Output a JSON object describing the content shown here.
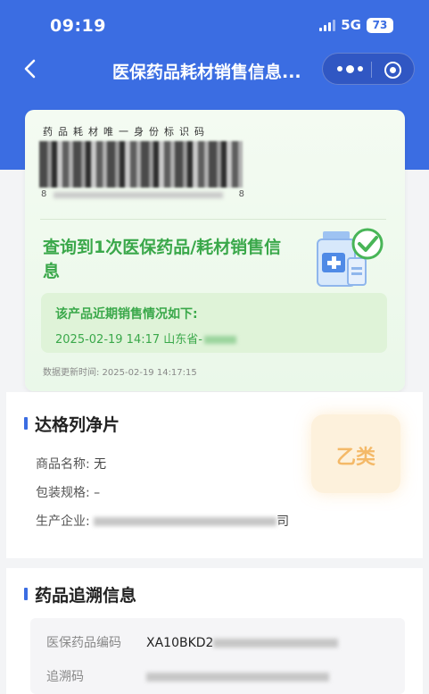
{
  "status_bar": {
    "time": "09:19",
    "network": "5G",
    "battery": "73"
  },
  "nav": {
    "title": "医保药品耗材销售信息..."
  },
  "card": {
    "code_label": "药品耗材唯一身份标识码",
    "barcode_start": "8",
    "barcode_end": "8",
    "result_text": "查询到1次医保药品/耗材销售信息",
    "sales_title": "该产品近期销售情况如下:",
    "sales_record": "2025-02-19 14:17 山东省-",
    "update_time": "数据更新时间: 2025-02-19 14:17:15"
  },
  "product": {
    "title": "达格列净片",
    "badge": "乙类",
    "name_label": "商品名称:",
    "name_value": "无",
    "spec_label": "包装规格:",
    "spec_value": "–",
    "maker_label": "生产企业:",
    "maker_suffix": "司"
  },
  "trace": {
    "title": "药品追溯信息",
    "rows": [
      {
        "label": "医保药品编码",
        "value": "XA10BKD2"
      },
      {
        "label": "追溯码",
        "value": ""
      }
    ]
  },
  "colors": {
    "primary": "#3b6de2",
    "green": "#3aa84a",
    "badge": "#f4b968"
  },
  "icons": [
    "signal-icon",
    "back-arrow-icon",
    "more-dots-icon",
    "close-target-icon",
    "medicine-check-icon"
  ]
}
